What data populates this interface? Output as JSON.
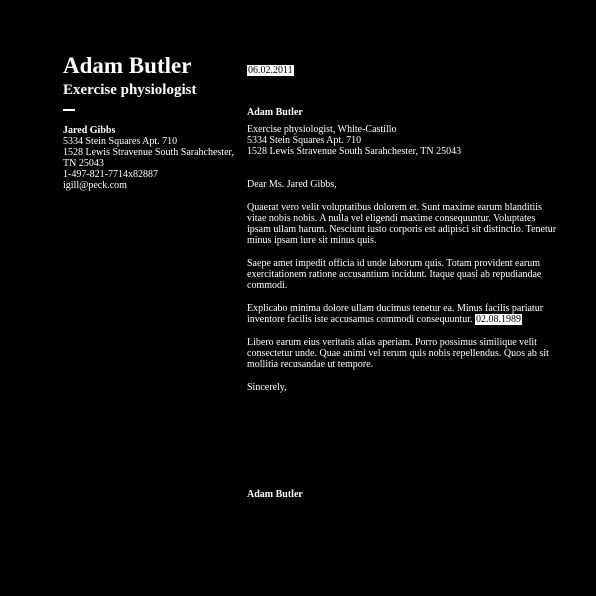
{
  "sidebar": {
    "name": "Adam Butler",
    "title": "Exercise physiologist",
    "recipient": {
      "name": "Jared Gibbs",
      "address1": "5334 Stein Squares Apt. 710",
      "address2": "1528 Lewis Stravenue South Sarahchester,",
      "address3": "TN 25043",
      "phone": "1-497-821-7714x82887",
      "email": "igill@peck.com"
    }
  },
  "letter": {
    "date": "06.02.2011",
    "sender": {
      "name": "Adam Butler",
      "line1": "Exercise physiologist, White-Castillo",
      "line2": "5334 Stein Squares Apt. 710",
      "line3": "1528 Lewis Stravenue South Sarahchester, TN 25043"
    },
    "salutation": "Dear Ms. Jared Gibbs,",
    "paragraphs": [
      "Quaerat vero velit voluptatibus dolorem et. Sunt maxime earum blanditiis vitae nobis nobis. A nulla vel eligendi maxime consequuntur. Voluptates ipsam ullam harum. Nesciunt iusto corporis est adipisci sit distinctio. Tenetur minus ipsam iure sit minus quis.",
      "Saepe amet impedit officia id unde laborum quis. Totam provident earum exercitationem ratione accusantium incidunt. Itaque quasi ab repudiandae commodi.",
      "Explicabo minima dolore ullam ducimus tenetur ea. Minus facilis pariatur inventore facilis iste accusamus commodi consequuntur.",
      "Libero earum eius veritatis alias aperiam. Porro possimus similique velit consectetur unde. Quae animi vel rerum quis nobis repellendus. Quos ab sit mollitia recusandae ut tempore."
    ],
    "highlight_date": "02.08.1989",
    "closing": "Sincerely,",
    "signature": "Adam Butler"
  }
}
